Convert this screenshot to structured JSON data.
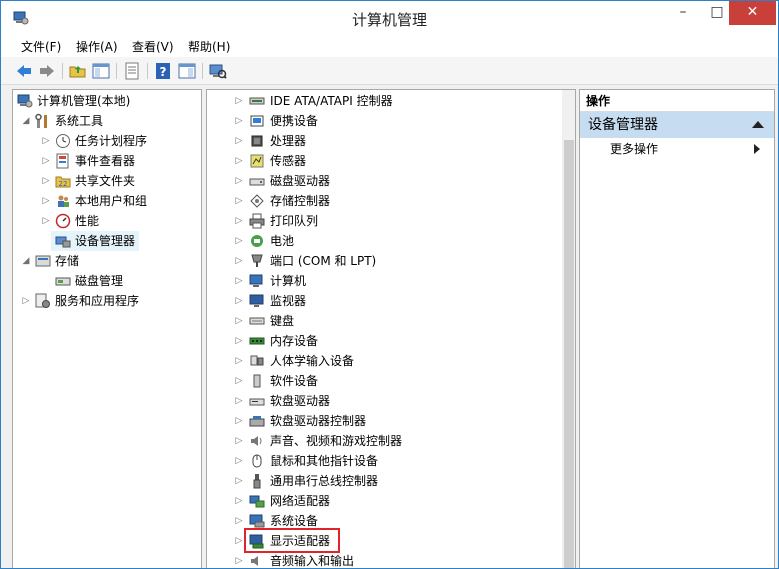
{
  "window": {
    "title": "计算机管理",
    "controls": {
      "minimize": "–",
      "maximize": "□",
      "close": "✕"
    }
  },
  "menu": [
    "文件(F)",
    "操作(A)",
    "查看(V)",
    "帮助(H)"
  ],
  "toolbar_icons": [
    "back-arrow-icon",
    "forward-arrow-icon",
    "up-folder-icon",
    "show-hide-console-tree-icon",
    "properties-icon",
    "help-icon",
    "show-action-pane-icon",
    "scan-hardware-icon"
  ],
  "left_tree": [
    {
      "label": "计算机管理(本地)",
      "icon": "computer-management-icon",
      "level": 0,
      "arrow": ""
    },
    {
      "label": "系统工具",
      "icon": "system-tools-icon",
      "level": 1,
      "arrow": "◢"
    },
    {
      "label": "任务计划程序",
      "icon": "clock-icon",
      "level": 2,
      "arrow": "▷"
    },
    {
      "label": "事件查看器",
      "icon": "event-viewer-icon",
      "level": 2,
      "arrow": "▷"
    },
    {
      "label": "共享文件夹",
      "icon": "shared-folder-icon",
      "level": 2,
      "arrow": "▷"
    },
    {
      "label": "本地用户和组",
      "icon": "users-icon",
      "level": 2,
      "arrow": "▷"
    },
    {
      "label": "性能",
      "icon": "performance-icon",
      "level": 2,
      "arrow": "▷"
    },
    {
      "label": "设备管理器",
      "icon": "device-manager-icon",
      "level": 2,
      "arrow": "",
      "selected": true
    },
    {
      "label": "存储",
      "icon": "storage-icon",
      "level": 1,
      "arrow": "◢"
    },
    {
      "label": "磁盘管理",
      "icon": "disk-management-icon",
      "level": 2,
      "arrow": ""
    },
    {
      "label": "服务和应用程序",
      "icon": "services-icon",
      "level": 1,
      "arrow": "▷"
    }
  ],
  "devices": [
    {
      "label": "IDE ATA/ATAPI 控制器",
      "icon": "ide-controller-icon"
    },
    {
      "label": "便携设备",
      "icon": "portable-device-icon"
    },
    {
      "label": "处理器",
      "icon": "processor-icon"
    },
    {
      "label": "传感器",
      "icon": "sensor-icon"
    },
    {
      "label": "磁盘驱动器",
      "icon": "disk-drive-icon"
    },
    {
      "label": "存储控制器",
      "icon": "storage-controller-icon"
    },
    {
      "label": "打印队列",
      "icon": "printer-icon"
    },
    {
      "label": "电池",
      "icon": "battery-icon"
    },
    {
      "label": "端口 (COM 和 LPT)",
      "icon": "port-icon"
    },
    {
      "label": "计算机",
      "icon": "computer-icon"
    },
    {
      "label": "监视器",
      "icon": "monitor-icon"
    },
    {
      "label": "键盘",
      "icon": "keyboard-icon"
    },
    {
      "label": "内存设备",
      "icon": "memory-icon"
    },
    {
      "label": "人体学输入设备",
      "icon": "hid-icon"
    },
    {
      "label": "软件设备",
      "icon": "software-device-icon"
    },
    {
      "label": "软盘驱动器",
      "icon": "floppy-drive-icon"
    },
    {
      "label": "软盘驱动器控制器",
      "icon": "floppy-controller-icon"
    },
    {
      "label": "声音、视频和游戏控制器",
      "icon": "sound-icon"
    },
    {
      "label": "鼠标和其他指针设备",
      "icon": "mouse-icon"
    },
    {
      "label": "通用串行总线控制器",
      "icon": "usb-icon"
    },
    {
      "label": "网络适配器",
      "icon": "network-adapter-icon"
    },
    {
      "label": "系统设备",
      "icon": "system-device-icon"
    },
    {
      "label": "显示适配器",
      "icon": "display-adapter-icon",
      "highlighted": true
    },
    {
      "label": "音频输入和输出",
      "icon": "audio-io-icon"
    }
  ],
  "actions": {
    "header": "操作",
    "section": "设备管理器",
    "more": "更多操作"
  },
  "colors": {
    "highlight_border": "#e0242c",
    "selected_bg": "#e5f3fb",
    "action_section_bg": "#c6dcf0",
    "close_button": "#c9403b"
  }
}
